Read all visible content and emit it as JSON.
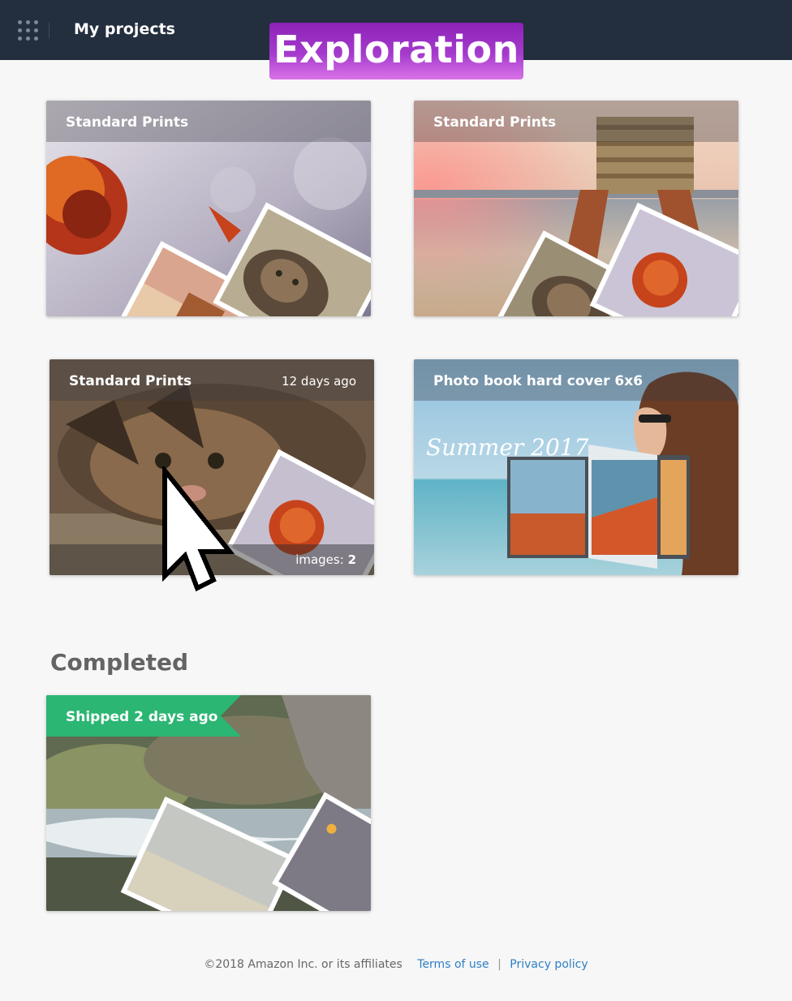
{
  "header": {
    "apps_icon": "grid-icon",
    "title": "My projects",
    "banner": "Exploration"
  },
  "projects": [
    {
      "title": "Standard Prints"
    },
    {
      "title": "Standard Prints"
    },
    {
      "title": "Standard Prints",
      "date": "12 days ago",
      "images_label": "images:",
      "images_count": "2"
    },
    {
      "title": "Photo book hard cover 6x6",
      "book_text": "Summer 2017"
    }
  ],
  "completed": {
    "heading": "Completed",
    "items": [
      {
        "status": "Shipped 2 days ago",
        "status_color": "#2bb673"
      }
    ]
  },
  "footer": {
    "copyright": "©2018 Amazon Inc. or its affiliates",
    "terms": "Terms of use",
    "separator": "|",
    "privacy": "Privacy policy"
  },
  "colors": {
    "topbar": "#232f3e",
    "accent_banner": "#a53bcc",
    "link": "#2d7fc6",
    "shipped": "#2bb673"
  }
}
